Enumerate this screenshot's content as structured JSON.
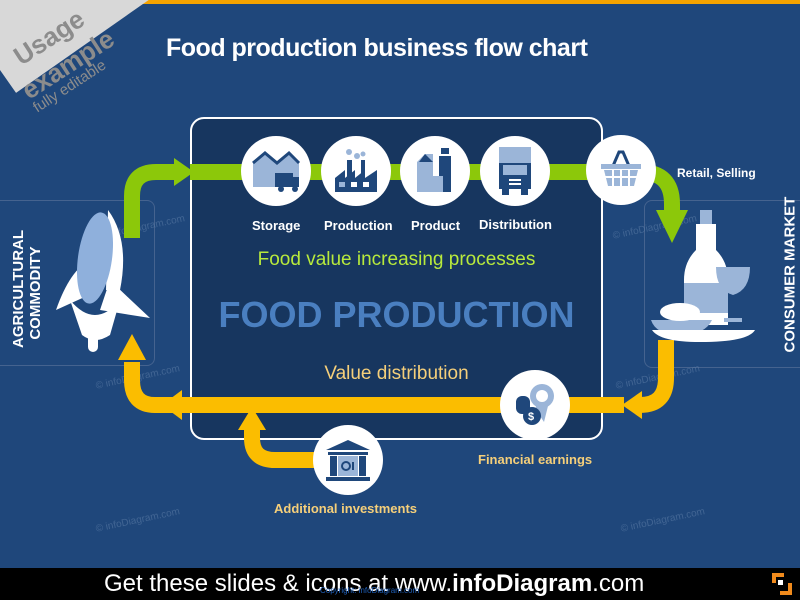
{
  "banner": {
    "line1": "Usage",
    "line2": "example",
    "line3": "fully editable"
  },
  "title": "Food production business flow chart",
  "left_side": {
    "label_line1": "AGRICULTURAL",
    "label_line2": "COMMODITY",
    "icon": "corn-icon"
  },
  "right_side": {
    "label": "CONSUMER MARKET",
    "icon": "food-and-wine-icon"
  },
  "process_steps": [
    {
      "label": "Storage",
      "icon": "warehouse-truck-icon"
    },
    {
      "label": "Production",
      "icon": "factory-icon"
    },
    {
      "label": "Product",
      "icon": "packaged-goods-icon"
    },
    {
      "label": "Distribution",
      "icon": "truck-front-icon"
    }
  ],
  "retail": {
    "label": "Retail, Selling",
    "icon": "shopping-basket-icon"
  },
  "center": {
    "subtitle_top": "Food value increasing processes",
    "heading": "FOOD PRODUCTION",
    "subtitle_bottom": "Value distribution"
  },
  "financial": {
    "label": "Financial earnings",
    "icon": "coins-award-icon"
  },
  "investments": {
    "label": "Additional investments",
    "icon": "bank-vault-icon"
  },
  "watermark": "© infoDiagram.com",
  "footer": {
    "text_pre": "Get these slides & icons at www.",
    "text_brand": "infoDiagram",
    "text_post": ".com",
    "copyright": "Copyright: infoDiagram.com"
  },
  "colors": {
    "background": "#1f477b",
    "green_arrow": "#8cc80a",
    "orange_arrow": "#fbbd00",
    "box": "#17365f",
    "icon_dark": "#1f477b",
    "icon_light": "#9bb5d8"
  }
}
